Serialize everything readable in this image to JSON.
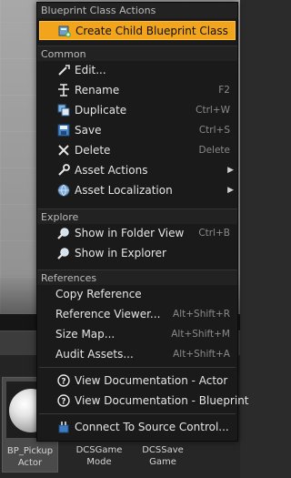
{
  "menu": {
    "sections": {
      "blueprint": "Blueprint Class Actions",
      "common": "Common",
      "explore": "Explore",
      "references": "References"
    },
    "blueprint_items": [
      {
        "label": "Create Child Blueprint Class",
        "icon": "blueprint-child-icon"
      }
    ],
    "common_items": [
      {
        "label": "Edit...",
        "icon": "edit-wand-icon",
        "shortcut": ""
      },
      {
        "label": "Rename",
        "icon": "rename-icon",
        "shortcut": "F2"
      },
      {
        "label": "Duplicate",
        "icon": "duplicate-icon",
        "shortcut": "Ctrl+W"
      },
      {
        "label": "Save",
        "icon": "save-icon",
        "shortcut": "Ctrl+S"
      },
      {
        "label": "Delete",
        "icon": "delete-icon",
        "shortcut": "Delete"
      },
      {
        "label": "Asset Actions",
        "icon": "wrench-icon",
        "submenu": true
      },
      {
        "label": "Asset Localization",
        "icon": "globe-icon",
        "submenu": true
      }
    ],
    "explore_items": [
      {
        "label": "Show in Folder View",
        "icon": "magnifier-icon",
        "shortcut": "Ctrl+B"
      },
      {
        "label": "Show in Explorer",
        "icon": "magnifier-icon",
        "shortcut": ""
      }
    ],
    "reference_items": [
      {
        "label": "Copy Reference",
        "shortcut": ""
      },
      {
        "label": "Reference Viewer...",
        "shortcut": "Alt+Shift+R"
      },
      {
        "label": "Size Map...",
        "shortcut": "Alt+Shift+M"
      },
      {
        "label": "Audit Assets...",
        "shortcut": "Alt+Shift+A"
      }
    ],
    "doc_items": [
      {
        "label": "View Documentation - Actor",
        "icon": "help-icon"
      },
      {
        "label": "View Documentation - Blueprint",
        "icon": "help-icon"
      }
    ],
    "source_control": {
      "label": "Connect To Source Control...",
      "icon": "source-control-icon"
    }
  },
  "assets": [
    {
      "label": "BP_Pickup\nActor",
      "selected": true
    },
    {
      "label": "DCSGame\nMode",
      "selected": false
    },
    {
      "label": "DCSSave\nGame",
      "selected": false
    }
  ],
  "colors": {
    "highlight": "#f2a51c",
    "menu_bg": "#1a1a1a"
  }
}
